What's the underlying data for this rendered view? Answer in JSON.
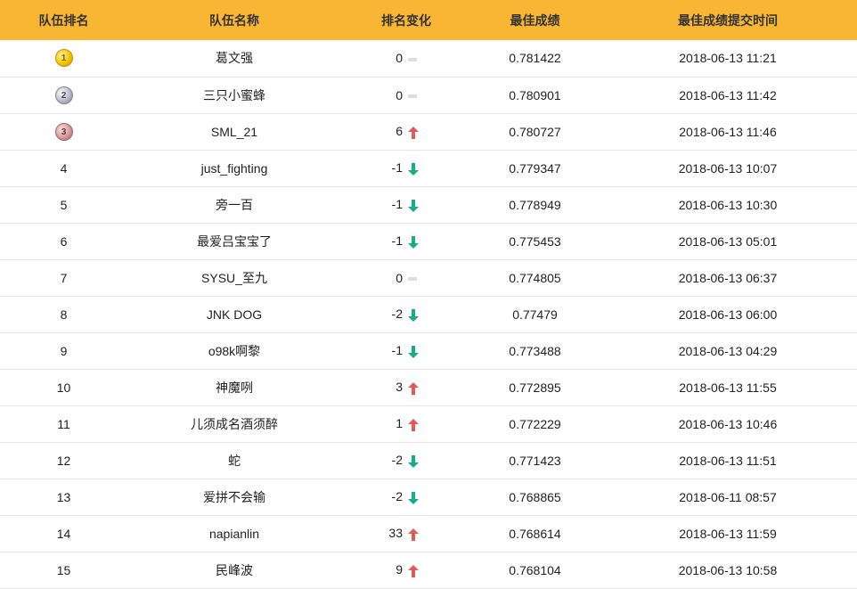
{
  "headers": {
    "rank": "队伍排名",
    "team": "队伍名称",
    "change": "排名变化",
    "best": "最佳成绩",
    "time": "最佳成绩提交时间"
  },
  "rows": [
    {
      "rank": "1",
      "medal": "gold",
      "team": "葛文强",
      "change": "0",
      "trend": "same",
      "score": "0.781422",
      "time": "2018-06-13 11:21"
    },
    {
      "rank": "2",
      "medal": "silver",
      "team": "三只小蜜蜂",
      "change": "0",
      "trend": "same",
      "score": "0.780901",
      "time": "2018-06-13 11:42"
    },
    {
      "rank": "3",
      "medal": "bronze",
      "team": "SML_21",
      "change": "6",
      "trend": "up",
      "score": "0.780727",
      "time": "2018-06-13 11:46"
    },
    {
      "rank": "4",
      "medal": null,
      "team": "just_fighting",
      "change": "-1",
      "trend": "down",
      "score": "0.779347",
      "time": "2018-06-13 10:07"
    },
    {
      "rank": "5",
      "medal": null,
      "team": "旁一百",
      "change": "-1",
      "trend": "down",
      "score": "0.778949",
      "time": "2018-06-13 10:30"
    },
    {
      "rank": "6",
      "medal": null,
      "team": "最爱吕宝宝了",
      "change": "-1",
      "trend": "down",
      "score": "0.775453",
      "time": "2018-06-13 05:01"
    },
    {
      "rank": "7",
      "medal": null,
      "team": "SYSU_至九",
      "change": "0",
      "trend": "same",
      "score": "0.774805",
      "time": "2018-06-13 06:37"
    },
    {
      "rank": "8",
      "medal": null,
      "team": "JNK DOG",
      "change": "-2",
      "trend": "down",
      "score": "0.77479",
      "time": "2018-06-13 06:00"
    },
    {
      "rank": "9",
      "medal": null,
      "team": "o98k啊黎",
      "change": "-1",
      "trend": "down",
      "score": "0.773488",
      "time": "2018-06-13 04:29"
    },
    {
      "rank": "10",
      "medal": null,
      "team": "神魔咧",
      "change": "3",
      "trend": "up",
      "score": "0.772895",
      "time": "2018-06-13 11:55"
    },
    {
      "rank": "11",
      "medal": null,
      "team": "儿须成名酒须醉",
      "change": "1",
      "trend": "up",
      "score": "0.772229",
      "time": "2018-06-13 10:46"
    },
    {
      "rank": "12",
      "medal": null,
      "team": "蛇",
      "change": "-2",
      "trend": "down",
      "score": "0.771423",
      "time": "2018-06-13 11:51"
    },
    {
      "rank": "13",
      "medal": null,
      "team": "爱拼不会输",
      "change": "-2",
      "trend": "down",
      "score": "0.768865",
      "time": "2018-06-11 08:57"
    },
    {
      "rank": "14",
      "medal": null,
      "team": "napianlin",
      "change": "33",
      "trend": "up",
      "score": "0.768614",
      "time": "2018-06-13 11:59"
    },
    {
      "rank": "15",
      "medal": null,
      "team": "民峰波",
      "change": "9",
      "trend": "up",
      "score": "0.768104",
      "time": "2018-06-13 10:58"
    }
  ],
  "colors": {
    "header_bg": "#f9b633",
    "up": "#e05a5a",
    "down": "#1aab8a",
    "same": "#dddddd"
  }
}
